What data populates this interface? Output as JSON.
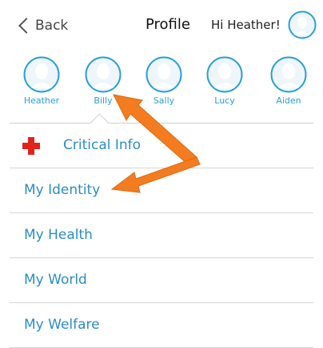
{
  "nav": {
    "back_label": "Back",
    "title": "Profile",
    "greeting": "Hi Heather!"
  },
  "profiles": [
    {
      "name": "Heather"
    },
    {
      "name": "Billy"
    },
    {
      "name": "Sally"
    },
    {
      "name": "Lucy"
    },
    {
      "name": "Aiden"
    }
  ],
  "selected_profile": "Billy",
  "menu": {
    "critical_info": "Critical Info",
    "items": [
      {
        "label": "My Identity"
      },
      {
        "label": "My Health"
      },
      {
        "label": "My World"
      },
      {
        "label": "My Welfare"
      }
    ]
  },
  "colors": {
    "accent": "#2a8ec6",
    "avatar_ring": "#2a9fd8",
    "critical_red": "#e2231a",
    "annotation_arrow": "#f47c20"
  },
  "icons": {
    "back": "chevron-left-icon",
    "avatar": "person-silhouette-icon",
    "critical": "red-cross-icon"
  }
}
